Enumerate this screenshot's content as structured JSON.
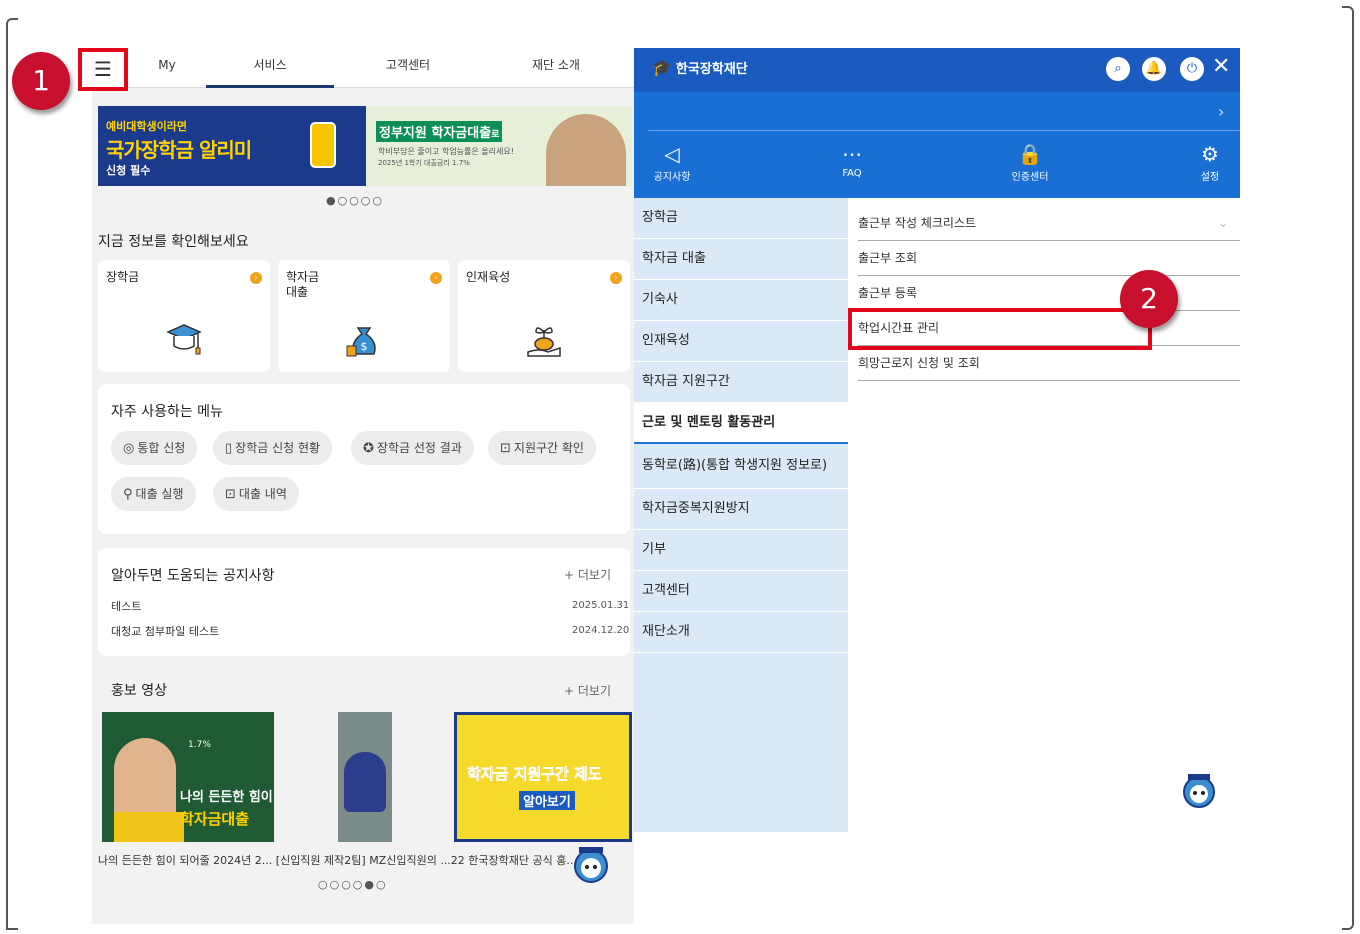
{
  "tabs": [
    "My",
    "서비스",
    "고객센터",
    "재단 소개"
  ],
  "banner": {
    "left_line1": "예비대학생이라면",
    "left_line2": "국가장학금 알리미",
    "left_line3": "신청 필수",
    "right_title": "정부지원 학자금대출",
    "right_title_suffix": "로",
    "right_line1": "학비부담은 줄이고 학업능률은 올리세요!",
    "right_line2": "2025년 1학기 대출금리 1.7%",
    "dots": "●○○○○"
  },
  "info": {
    "title": "지금 정보를 확인해보세요",
    "cards": [
      "장학금",
      "학자금\n대출",
      "인재육성"
    ]
  },
  "freq": {
    "title": "자주 사용하는 메뉴",
    "chips": [
      "통합 신청",
      "장학금 신청 현황",
      "장학금 선정 결과",
      "지원구간 확인",
      "대출 실행",
      "대출 내역"
    ]
  },
  "notice": {
    "title": "알아두면 도움되는 공지사항",
    "more": "+ 더보기",
    "items": [
      {
        "title": "테스트",
        "date": "2025.01.31"
      },
      {
        "title": "대청교 첨부파일 테스트",
        "date": "2024.12.20"
      }
    ]
  },
  "video": {
    "title": "홍보 영상",
    "more": "+ 더보기",
    "thumb1_text1": "나의 든든한 힘이",
    "thumb1_text2": "학자금대출",
    "thumb1_num": "1.7%",
    "thumb3_text1": "학자금 지원구간 제도",
    "thumb3_text2": "알아보기",
    "caption": "나의 든든한 힘이 되어줄 2024년 2... [신입직원 제작2팀] MZ신입직원의 ...22 한국장학재단 공식 홍...",
    "dots": "○○○○●○"
  },
  "menu": {
    "logo": "한국장학재단",
    "quick": [
      "공지사항",
      "FAQ",
      "인증센터",
      "설정"
    ],
    "categories": [
      "장학금",
      "학자금 대출",
      "기숙사",
      "인재육성",
      "학자금 지원구간",
      "근로 및 멘토링 활동관리",
      "동학로(路)(통합 학생지원 정보로)",
      "학자금중복지원방지",
      "기부",
      "고객센터",
      "재단소개"
    ],
    "subitems": [
      "출근부 작성 체크리스트",
      "출근부 조회",
      "출근부 등록",
      "학업시간표 관리",
      "희망근로지 신청 및 조회"
    ]
  },
  "badges": [
    "1",
    "2"
  ],
  "colors": {
    "accent": "#1b5bbf",
    "highlight": "#e3051b",
    "category_bg": "#dbe8f7"
  }
}
